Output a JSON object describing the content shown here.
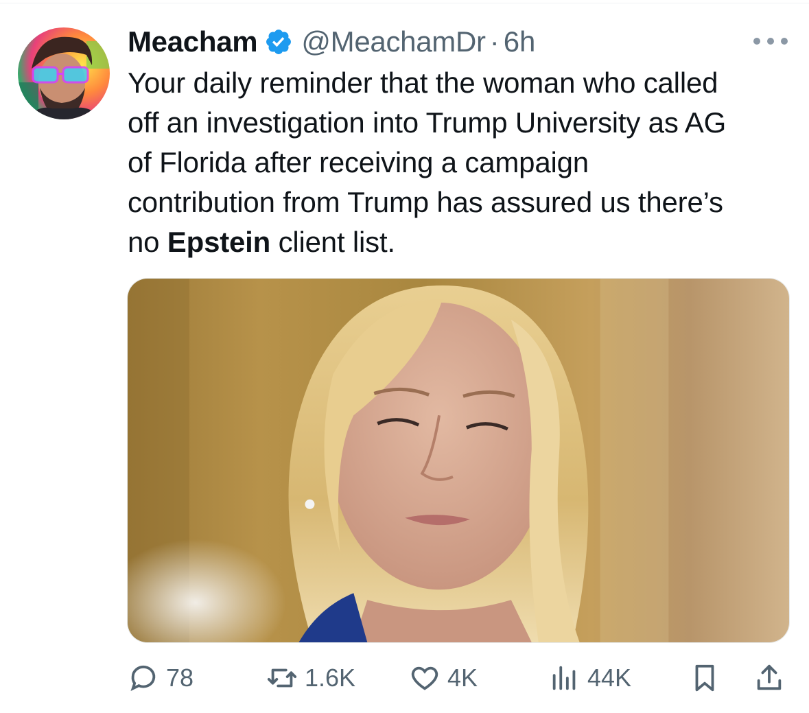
{
  "tweet": {
    "display_name": "Meacham",
    "verified_icon": "verified-badge-icon",
    "handle": "@MeachamDr",
    "separator": "·",
    "time": "6h",
    "text_lines": [
      "Your daily reminder that the woman who called",
      "off an investigation into Trump University as AG",
      "of Florida after receiving a campaign",
      "contribution from Trump has assured us there’s"
    ],
    "last_line": {
      "prefix": "no ",
      "bold": "Epstein",
      "suffix": " client list."
    }
  },
  "actions": {
    "reply": {
      "icon": "reply-icon",
      "count": "78"
    },
    "retweet": {
      "icon": "retweet-icon",
      "count": "1.6K"
    },
    "like": {
      "icon": "heart-icon",
      "count": "4K"
    },
    "views": {
      "icon": "views-icon",
      "count": "44K"
    },
    "bookmark": {
      "icon": "bookmark-icon"
    },
    "share": {
      "icon": "share-icon"
    }
  },
  "colors": {
    "text": "#0f1419",
    "secondary": "#536471",
    "verified": "#1d9bf0"
  }
}
